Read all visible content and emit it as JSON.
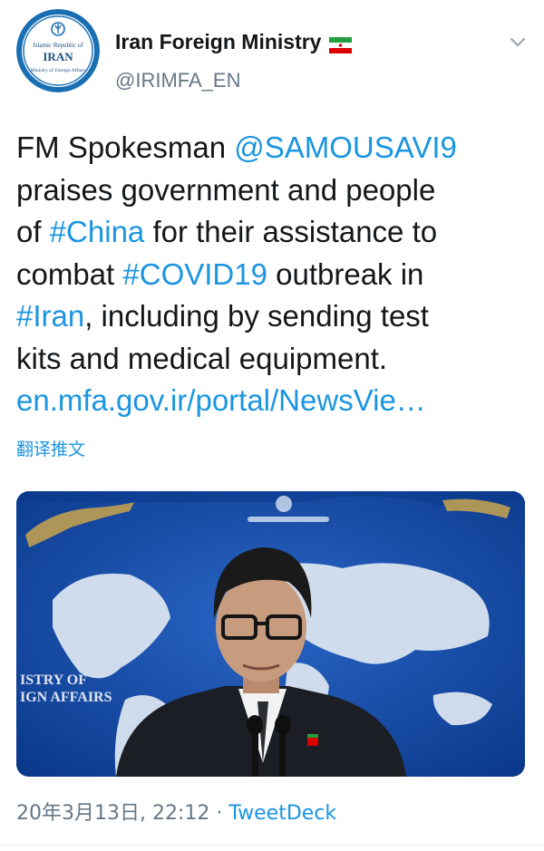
{
  "author": {
    "name": "Iran Foreign Ministry",
    "handle": "@IRIMFA_EN",
    "avatar_text": {
      "line1": "Islamic Republic of",
      "line2": "IRAN",
      "line3": "Ministry of Foreign Affairs"
    }
  },
  "tweet": {
    "lines": [
      [
        {
          "t": "FM Spokesman ",
          "link": false
        },
        {
          "t": "@SAMOUSAVI9",
          "link": true
        }
      ],
      [
        {
          "t": "praises government and people",
          "link": false
        }
      ],
      [
        {
          "t": "of ",
          "link": false
        },
        {
          "t": "#China",
          "link": true
        },
        {
          "t": " for their assistance to",
          "link": false
        }
      ],
      [
        {
          "t": "combat ",
          "link": false
        },
        {
          "t": "#COVID19",
          "link": true
        },
        {
          "t": " outbreak in",
          "link": false
        }
      ],
      [
        {
          "t": "#Iran",
          "link": true
        },
        {
          "t": ", including by sending test",
          "link": false
        }
      ],
      [
        {
          "t": "kits and medical equipment.",
          "link": false
        }
      ],
      [
        {
          "t": "en.mfa.gov.ir/portal/NewsVie…",
          "link": true
        }
      ]
    ],
    "translate_label": "翻译推文"
  },
  "media": {
    "backdrop_text": [
      "ISTRY OF",
      "IGN AFFAIRS"
    ]
  },
  "meta": {
    "timestamp": "20年3月13日, 22:12",
    "separator": " · ",
    "source": "TweetDeck"
  },
  "colors": {
    "link": "#1b95e0",
    "text": "#14171a",
    "secondary": "#657786",
    "map_blue": "#0e3f92"
  },
  "icons": [
    "chevron-down-icon",
    "iran-flag-icon",
    "ministry-emblem-icon"
  ]
}
